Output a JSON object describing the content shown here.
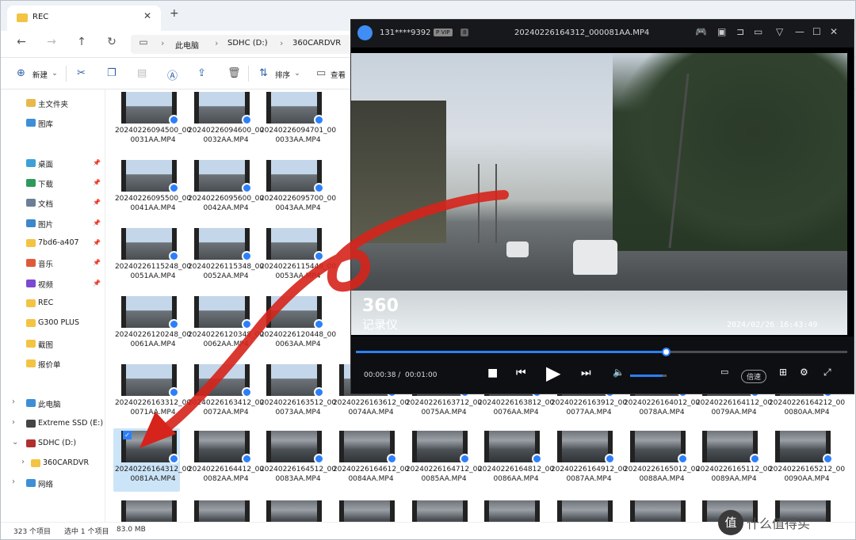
{
  "tab": {
    "title": "REC"
  },
  "address": {
    "crumbs": [
      "此电脑",
      "SDHC (D:)",
      "360CARDVR"
    ]
  },
  "toolbar": {
    "new_label": "新建",
    "sort_label": "排序",
    "view_label": "查看"
  },
  "sidebar": {
    "items": [
      {
        "label": "主文件夹",
        "icon": "home-icon",
        "color": "#e8b84a"
      },
      {
        "label": "图库",
        "icon": "gallery-icon",
        "color": "#3e8ed8"
      },
      {
        "label": "桌面",
        "icon": "desktop-icon",
        "color": "#3ea0d9",
        "pinned": true
      },
      {
        "label": "下载",
        "icon": "download-icon",
        "color": "#2d9a5b",
        "pinned": true
      },
      {
        "label": "文档",
        "icon": "document-icon",
        "color": "#6b7f96",
        "pinned": true
      },
      {
        "label": "图片",
        "icon": "pictures-icon",
        "color": "#3b87c9",
        "pinned": true
      },
      {
        "label": "7bd6-a407",
        "icon": "folder-icon",
        "color": "#f3c343",
        "pinned": true
      },
      {
        "label": "音乐",
        "icon": "music-icon",
        "color": "#e05a3a",
        "pinned": true
      },
      {
        "label": "视频",
        "icon": "video-icon",
        "color": "#7b4ad1",
        "pinned": true
      },
      {
        "label": "REC",
        "icon": "folder-icon",
        "color": "#f3c343"
      },
      {
        "label": "G300 PLUS",
        "icon": "folder-icon",
        "color": "#f3c343"
      },
      {
        "label": "截图",
        "icon": "folder-icon",
        "color": "#f3c343"
      },
      {
        "label": "报价单",
        "icon": "folder-icon",
        "color": "#f3c343"
      }
    ],
    "drives": [
      {
        "label": "此电脑",
        "icon": "pc-icon",
        "color": "#3e8ed8"
      },
      {
        "label": "Extreme SSD (E:)",
        "icon": "drive-icon",
        "color": "#444444"
      },
      {
        "label": "SDHC (D:)",
        "icon": "sd-card-icon",
        "color": "#b03030"
      },
      {
        "label": "360CARDVR",
        "icon": "folder-icon",
        "color": "#f3c343"
      },
      {
        "label": "网络",
        "icon": "network-icon",
        "color": "#3e8ed8"
      }
    ]
  },
  "files": [
    {
      "name": "20240226094500_000031AA.MP4"
    },
    {
      "name": "20240226094600_000032AA.MP4"
    },
    {
      "name": "20240226094701_000033AA.MP4"
    },
    {
      "name": "20240226095500_000041AA.MP4"
    },
    {
      "name": "20240226095600_000042AA.MP4"
    },
    {
      "name": "20240226095700_000043AA.MP4"
    },
    {
      "name": "20240226115248_000051AA.MP4"
    },
    {
      "name": "20240226115348_000052AA.MP4"
    },
    {
      "name": "20240226115448_000053AA.MP4"
    },
    {
      "name": "20240226120248_000061AA.MP4"
    },
    {
      "name": "20240226120348_000062AA.MP4"
    },
    {
      "name": "20240226120448_000063AA.MP4"
    },
    {
      "name": "20240226163312_000071AA.MP4"
    },
    {
      "name": "20240226163412_000072AA.MP4"
    },
    {
      "name": "20240226163512_000073AA.MP4"
    },
    {
      "name": "20240226163612_000074AA.MP4"
    },
    {
      "name": "20240226163712_000075AA.MP4"
    },
    {
      "name": "20240226163812_000076AA.MP4"
    },
    {
      "name": "20240226163912_000077AA.MP4"
    },
    {
      "name": "20240226164012_000078AA.MP4"
    },
    {
      "name": "20240226164112_000079AA.MP4"
    },
    {
      "name": "20240226164212_000080AA.MP4"
    },
    {
      "name": "20240226164312_000081AA.MP4"
    },
    {
      "name": "20240226164412_000082AA.MP4"
    },
    {
      "name": "20240226164512_000083AA.MP4"
    },
    {
      "name": "20240226164612_000084AA.MP4"
    },
    {
      "name": "20240226164712_000085AA.MP4"
    },
    {
      "name": "20240226164812_000086AA.MP4"
    },
    {
      "name": "20240226164912_000087AA.MP4"
    },
    {
      "name": "20240226165012_000088AA.MP4"
    },
    {
      "name": "20240226165112_000089AA.MP4"
    },
    {
      "name": "20240226165212_000090AA.MP4"
    }
  ],
  "status": {
    "count": "323 个项目",
    "selected": "选中 1 个项目",
    "size": "83.0 MB"
  },
  "player": {
    "user": "131****9392",
    "vip_badge": "P VIP",
    "level_badge": "8",
    "file_title": "20240226164312_000081AA.MP4",
    "time_current": "00:00:38 /",
    "time_total": "00:01:00",
    "progress_pct": 63,
    "volume_pct": 90,
    "speed_label": "倍速",
    "overlay_logo": "360",
    "overlay_logo_sub": "记录仪",
    "timestamp": "2024/02/26 16:43:49"
  },
  "watermark": {
    "text": "什么值得买",
    "icon": "值"
  },
  "colors": {
    "accent": "#2d7ff9",
    "annotation_arrow": "#d6231b"
  }
}
